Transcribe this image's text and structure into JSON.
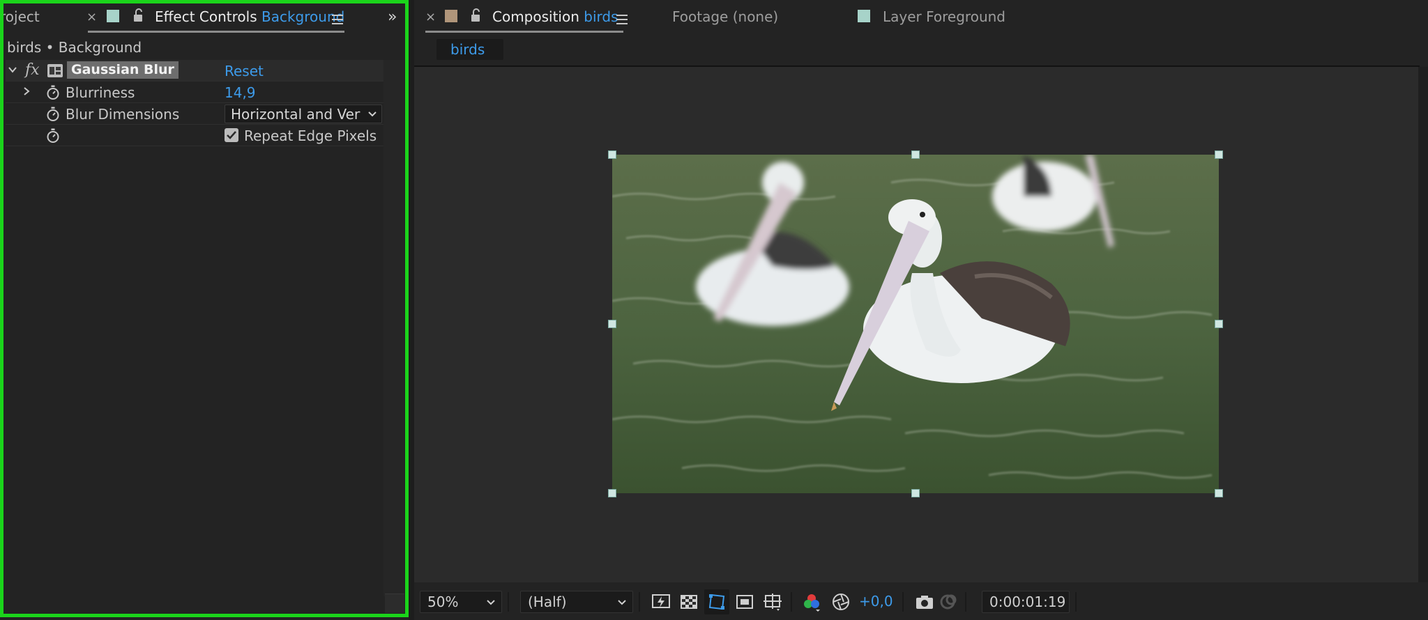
{
  "left_panel": {
    "project_tab_label": "roject",
    "effect_controls_tab": {
      "title": "Effect Controls",
      "layer": "Background"
    },
    "layer_path": "birds • Background",
    "effect": {
      "name": "Gaussian Blur",
      "reset_label": "Reset",
      "params": {
        "blurriness": {
          "label": "Blurriness",
          "value": "14,9"
        },
        "blur_dimensions": {
          "label": "Blur Dimensions",
          "value": "Horizontal and Verti"
        },
        "repeat_edge_pixels": {
          "label": "Repeat Edge Pixels",
          "checked": true
        }
      }
    }
  },
  "composition_panel": {
    "tab": {
      "title": "Composition",
      "name": "birds"
    },
    "footage_tab": "Footage (none)",
    "layer_tab": "Layer Foreground",
    "active_comp_tab": "birds",
    "footer": {
      "zoom": "50%",
      "resolution": "(Half)",
      "exposure": "+0,0",
      "timecode": "0:00:01:19"
    }
  },
  "colors": {
    "accent": "#3d9bea",
    "focus_border": "#1bd41b",
    "background_layer_label": "#a7d3c9",
    "comp_label": "#b0957a"
  },
  "icons": [
    "close-icon",
    "lock-icon",
    "panel-menu-icon",
    "overflow-chevron-icon",
    "disclosure-chevron-icon",
    "fx-icon",
    "effect-badge-icon",
    "stopwatch-icon",
    "dropdown-chevron-icon",
    "checkbox-icon",
    "fast-previews-icon",
    "transparency-grid-icon",
    "region-of-interest-icon",
    "mask-visibility-icon",
    "guides-icon",
    "color-channels-icon",
    "reset-exposure-icon",
    "snapshot-icon",
    "show-snapshot-icon"
  ]
}
